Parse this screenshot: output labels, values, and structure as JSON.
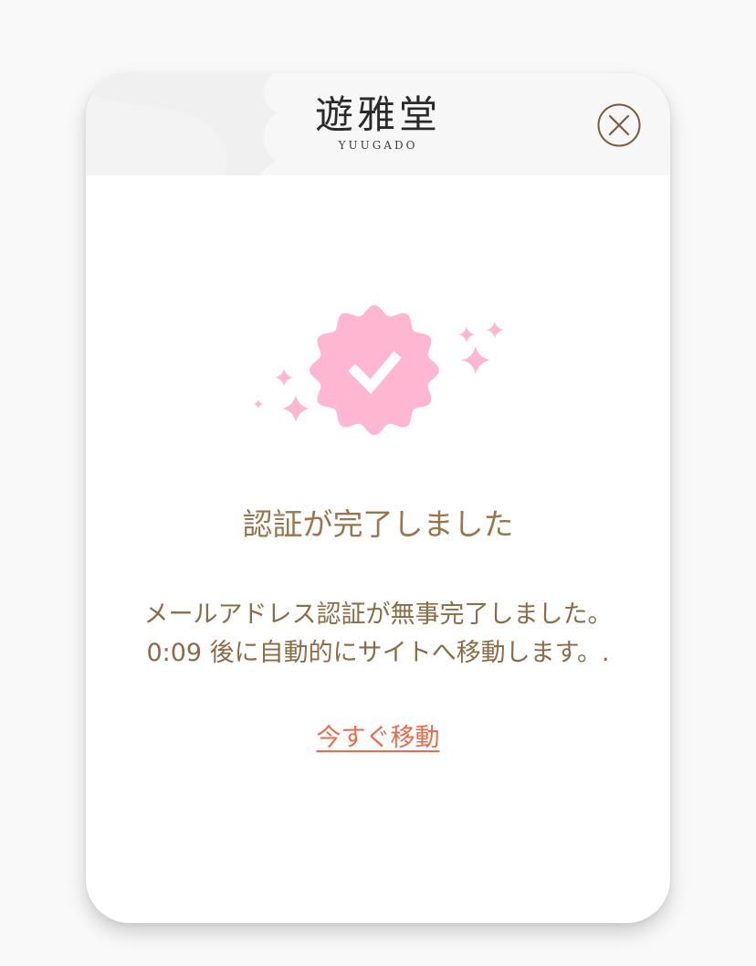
{
  "header": {
    "logo_kanji": "遊雅堂",
    "logo_roman": "YUUGADO"
  },
  "icons": {
    "close": "close-circle-icon",
    "badge": "verified-badge-check-icon",
    "sparkles": "sparkle-icon"
  },
  "colors": {
    "page_background": "#f9f9f9",
    "card_background": "#ffffff",
    "header_background": "#f7f7f7",
    "badge_pink": "#ffb6d1",
    "title_text": "#99754e",
    "body_text": "#8a6c47",
    "link_text": "#ec6a4b",
    "logo_accent": "#8b6a45"
  },
  "main": {
    "title": "認証が完了しました",
    "message_line1": "メールアドレス認証が無事完了しました。",
    "countdown": "0:09",
    "message_line2_suffix": " 後に自動的にサイトへ移動します。.",
    "link_label": "今すぐ移動"
  }
}
